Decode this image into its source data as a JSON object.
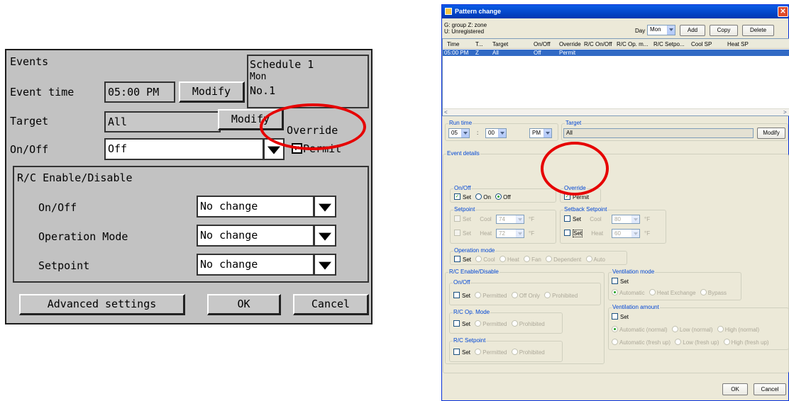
{
  "lcd": {
    "title": "Events",
    "schedule": {
      "line1": "Schedule 1",
      "line2": "Mon",
      "line3": "No.1"
    },
    "event_time_label": "Event time",
    "event_time_value": "05:00 PM",
    "modify_label": "Modify",
    "target_label": "Target",
    "target_value": "All",
    "override_label": "Override",
    "onoff_label": "On/Off",
    "onoff_value": "Off",
    "permit_label": "Permit",
    "rc_group_label": "R/C Enable/Disable",
    "rc_rows": [
      {
        "label": "On/Off",
        "value": "No change"
      },
      {
        "label": "Operation Mode",
        "value": "No change"
      },
      {
        "label": "Setpoint",
        "value": "No change"
      }
    ],
    "advanced_label": "Advanced settings",
    "ok_label": "OK",
    "cancel_label": "Cancel"
  },
  "win": {
    "title": "Pattern change",
    "legend_line1": "G: group Z: zone",
    "legend_line2": "U: Unregistered",
    "day_label": "Day",
    "day_value": "Mon",
    "add_label": "Add",
    "copy_label": "Copy",
    "delete_label": "Delete",
    "columns": [
      "Time",
      "T...",
      "Target",
      "On/Off",
      "Override",
      "R/C On/Off",
      "R/C Op. m...",
      "R/C Setpo...",
      "Cool SP",
      "Heat SP"
    ],
    "rows": [
      [
        "05:00 PM",
        "Z",
        "All",
        "Off",
        "Permit",
        "",
        "",
        "",
        "",
        ""
      ]
    ],
    "runtime_label": "Run time",
    "hour": "05",
    "colon": ":",
    "minute": "00",
    "ampm": "PM",
    "target_label": "Target",
    "target_value": "All",
    "modify_label": "Modify",
    "event_details_label": "Event details",
    "onoff": {
      "label": "On/Off",
      "set": "Set",
      "on": "On",
      "off": "Off"
    },
    "override": {
      "label": "Override",
      "permit": "Permit"
    },
    "setpoint": {
      "label": "Setpoint",
      "set": "Set",
      "cool": "Cool",
      "cool_value": "74",
      "heat": "Heat",
      "heat_value": "72",
      "unit": "°F"
    },
    "setback": {
      "label": "Setback Setpoint",
      "set": "Set",
      "cool": "Cool",
      "cool_value": "80",
      "heat": "Heat",
      "heat_value": "60",
      "unit": "°F"
    },
    "opmode": {
      "label": "Operation mode",
      "set": "Set",
      "options": [
        "Cool",
        "Heat",
        "Fan",
        "Dependent",
        "Auto"
      ]
    },
    "rc": {
      "label": "R/C Enable/Disable",
      "onoff": {
        "label": "On/Off",
        "set": "Set",
        "options": [
          "Permitted",
          "Off Only",
          "Prohibited"
        ]
      },
      "opmode": {
        "label": "R/C Op. Mode",
        "set": "Set",
        "options": [
          "Permitted",
          "Prohibited"
        ]
      },
      "setpoint": {
        "label": "R/C Setpoint",
        "set": "Set",
        "options": [
          "Permitted",
          "Prohibited"
        ]
      }
    },
    "vent_mode": {
      "label": "Ventilation mode",
      "set": "Set",
      "options": [
        "Automatic",
        "Heat Exchange",
        "Bypass"
      ]
    },
    "vent_amount": {
      "label": "Ventilation amount",
      "set": "Set",
      "row1": [
        "Automatic (normal)",
        "Low (normal)",
        "High (normal)"
      ],
      "row2": [
        "Automatic (fresh up)",
        "Low (fresh up)",
        "High (fresh up)"
      ]
    },
    "ok_label": "OK",
    "cancel_label": "Cancel"
  },
  "colors": {
    "highlight": "#e60000",
    "selection": "#316ac5",
    "titlebar": "#0a5ce6"
  }
}
